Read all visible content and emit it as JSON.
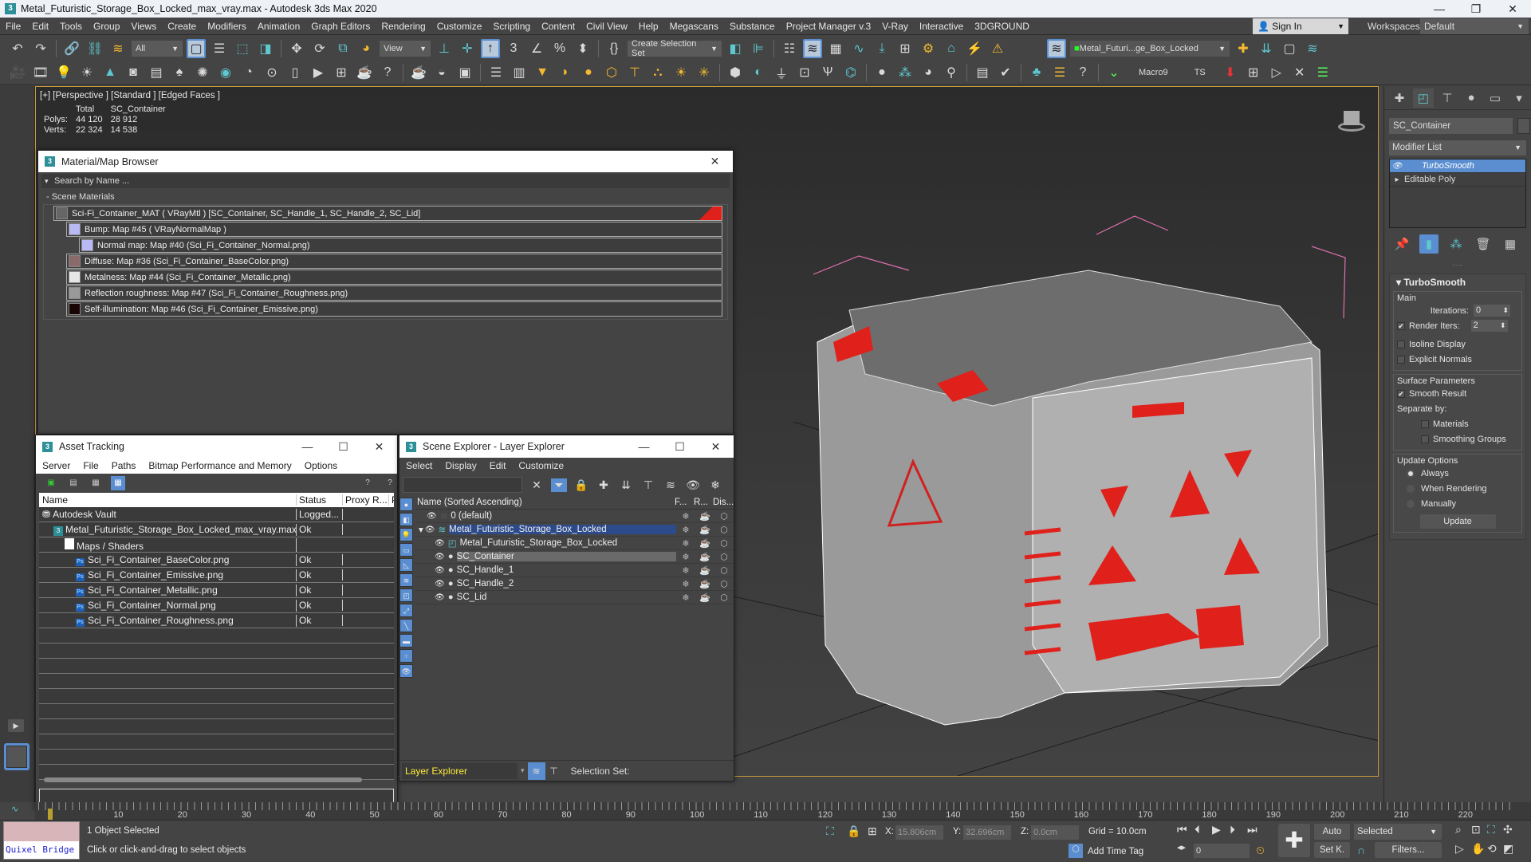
{
  "window": {
    "title": "Metal_Futuristic_Storage_Box_Locked_max_vray.max - Autodesk 3ds Max 2020",
    "app_icon": "3"
  },
  "menu": [
    "File",
    "Edit",
    "Tools",
    "Group",
    "Views",
    "Create",
    "Modifiers",
    "Animation",
    "Graph Editors",
    "Rendering",
    "Customize",
    "Scripting",
    "Content",
    "Civil View",
    "Help",
    "Megascans",
    "Substance",
    "Project Manager v.3",
    "V-Ray",
    "Interactive",
    "3DGROUND"
  ],
  "account": {
    "sign_in": "Sign In",
    "workspaces_label": "Workspaces:",
    "workspace": "Default"
  },
  "toolbar": {
    "selection_filter": "All",
    "ref_coord": "View",
    "selection_set": "Create Selection Set",
    "layer_dropdown": "Metal_Futuri...ge_Box_Locked",
    "macro_label": "Macro9",
    "ts_label": "TS"
  },
  "viewport": {
    "label": "[+] [Perspective ] [Standard ] [Edged Faces ]",
    "stats": {
      "col_total": "Total",
      "col_object": "SC_Container",
      "rows": [
        {
          "label": "Polys:",
          "total": "44 120",
          "object": "28 912"
        },
        {
          "label": "Verts:",
          "total": "22 324",
          "object": "14 538"
        }
      ]
    }
  },
  "material_browser": {
    "title": "Material/Map Browser",
    "search_placeholder": "Search by Name ...",
    "section": "- Scene Materials",
    "items": [
      {
        "text": "Sci-Fi_Container_MAT  ( VRayMtl )  [SC_Container, SC_Handle_1, SC_Handle_2, SC_Lid]",
        "indent": 0,
        "thumb": "#666666"
      },
      {
        "text": "Bump: Map #45  ( VRayNormalMap )",
        "indent": 1,
        "thumb": "#b9b9f5"
      },
      {
        "text": "Normal map: Map #40 (Sci_Fi_Container_Normal.png)",
        "indent": 2,
        "thumb": "#b9b9f5"
      },
      {
        "text": "Diffuse: Map #36 (Sci_Fi_Container_BaseColor.png)",
        "indent": 1,
        "thumb": "#8a6a6a"
      },
      {
        "text": "Metalness: Map #44 (Sci_Fi_Container_Metallic.png)",
        "indent": 1,
        "thumb": "#e6e6e6"
      },
      {
        "text": "Reflection roughness: Map #47 (Sci_Fi_Container_Roughness.png)",
        "indent": 1,
        "thumb": "#9a9a9a"
      },
      {
        "text": "Self-illumination: Map #46 (Sci_Fi_Container_Emissive.png)",
        "indent": 1,
        "thumb": "#1a0505"
      }
    ]
  },
  "asset_tracking": {
    "title": "Asset Tracking",
    "menu": [
      "Server",
      "File",
      "Paths",
      "Bitmap Performance and Memory",
      "Options"
    ],
    "columns": [
      "Name",
      "Status",
      "Proxy R...",
      "P"
    ],
    "rows": [
      {
        "name": "Autodesk Vault",
        "status": "Logged...",
        "indent": 1,
        "icon": "vault"
      },
      {
        "name": "Metal_Futuristic_Storage_Box_Locked_max_vray.max",
        "status": "Ok",
        "indent": 2,
        "icon": "max"
      },
      {
        "name": "Maps / Shaders",
        "status": "",
        "indent": 3,
        "icon": "folder"
      },
      {
        "name": "Sci_Fi_Container_BaseColor.png",
        "status": "Ok",
        "indent": 4,
        "icon": "ps"
      },
      {
        "name": "Sci_Fi_Container_Emissive.png",
        "status": "Ok",
        "indent": 4,
        "icon": "ps"
      },
      {
        "name": "Sci_Fi_Container_Metallic.png",
        "status": "Ok",
        "indent": 4,
        "icon": "ps"
      },
      {
        "name": "Sci_Fi_Container_Normal.png",
        "status": "Ok",
        "indent": 4,
        "icon": "ps"
      },
      {
        "name": "Sci_Fi_Container_Roughness.png",
        "status": "Ok",
        "indent": 4,
        "icon": "ps"
      }
    ]
  },
  "scene_explorer": {
    "title": "Scene Explorer - Layer Explorer",
    "menu": [
      "Select",
      "Display",
      "Edit",
      "Customize"
    ],
    "columns": {
      "name": "Name (Sorted Ascending)",
      "freeze": "F...",
      "render": "R...",
      "display": "Dis..."
    },
    "rows": [
      {
        "name": "0 (default)",
        "indent": 1,
        "type": "layer-default",
        "state": ""
      },
      {
        "name": "Metal_Futuristic_Storage_Box_Locked",
        "indent": 0,
        "type": "layer",
        "state": "selected"
      },
      {
        "name": "Metal_Futuristic_Storage_Box_Locked",
        "indent": 2,
        "type": "group",
        "state": ""
      },
      {
        "name": "SC_Container",
        "indent": 2,
        "type": "object",
        "state": "highlight"
      },
      {
        "name": "SC_Handle_1",
        "indent": 2,
        "type": "object",
        "state": ""
      },
      {
        "name": "SC_Handle_2",
        "indent": 2,
        "type": "object",
        "state": ""
      },
      {
        "name": "SC_Lid",
        "indent": 2,
        "type": "object",
        "state": ""
      }
    ],
    "footer": {
      "explorer": "Layer Explorer",
      "selection_set": "Selection Set:"
    }
  },
  "command_panel": {
    "object_name": "SC_Container",
    "modifier_list": "Modifier List",
    "stack": [
      {
        "name": "TurboSmooth",
        "selected": true
      },
      {
        "name": "Editable Poly",
        "selected": false
      }
    ],
    "rollout": {
      "title": "TurboSmooth",
      "main_label": "Main",
      "iterations_label": "Iterations:",
      "iterations": "0",
      "render_iters_label": "Render Iters:",
      "render_iters": "2",
      "render_iters_checked": true,
      "isoline_label": "Isoline Display",
      "isoline_checked": false,
      "explicit_label": "Explicit Normals",
      "explicit_checked": false,
      "surface_label": "Surface Parameters",
      "smooth_label": "Smooth Result",
      "smooth_checked": true,
      "separate_label": "Separate by:",
      "materials_label": "Materials",
      "smoothing_label": "Smoothing Groups",
      "update_label": "Update Options",
      "update_options": [
        "Always",
        "When Rendering",
        "Manually"
      ],
      "update_selected": "Always",
      "update_button": "Update"
    }
  },
  "timeline": {
    "current_frame": "0",
    "labels": [
      "10",
      "20",
      "30",
      "40",
      "50",
      "60",
      "70",
      "80",
      "90",
      "100",
      "110",
      "120",
      "130",
      "140",
      "150",
      "160",
      "170",
      "180",
      "190",
      "200",
      "210",
      "220"
    ]
  },
  "status": {
    "quixel": "Quixel Bridge",
    "selected": "1 Object Selected",
    "prompt": "Click or click-and-drag to select objects",
    "x_label": "X:",
    "x": "15.806cm",
    "y_label": "Y:",
    "y": "32.696cm",
    "z_label": "Z:",
    "z": "0.0cm",
    "grid": "Grid = 10.0cm",
    "add_time_tag": "Add Time Tag",
    "frame": "0",
    "auto": "Auto",
    "setk": "Set K.",
    "key_filter": "Selected",
    "filters": "Filters..."
  }
}
